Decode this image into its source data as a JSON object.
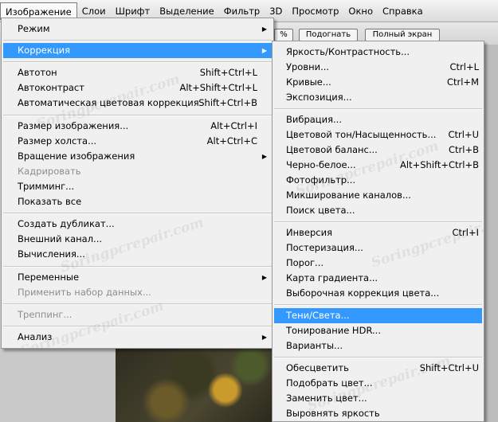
{
  "menubar": [
    "Изображение",
    "Слои",
    "Шрифт",
    "Выделение",
    "Фильтр",
    "3D",
    "Просмотр",
    "Окно",
    "Справка"
  ],
  "options_bar": {
    "fit_button": "Подогнать",
    "fullscreen_button": "Полный экран",
    "partial_button": "%"
  },
  "image_menu": {
    "mode": "Режим",
    "adjustments": "Коррекция",
    "auto_tone": {
      "label": "Автотон",
      "shortcut": "Shift+Ctrl+L"
    },
    "auto_contrast": {
      "label": "Автоконтраст",
      "shortcut": "Alt+Shift+Ctrl+L"
    },
    "auto_color": {
      "label": "Автоматическая цветовая коррекция",
      "shortcut": "Shift+Ctrl+B"
    },
    "image_size": {
      "label": "Размер изображения...",
      "shortcut": "Alt+Ctrl+I"
    },
    "canvas_size": {
      "label": "Размер холста...",
      "shortcut": "Alt+Ctrl+C"
    },
    "rotation": "Вращение изображения",
    "crop": "Кадрировать",
    "trim": "Тримминг...",
    "reveal_all": "Показать все",
    "duplicate": "Создать дубликат...",
    "apply_image": "Внешний канал...",
    "calculations": "Вычисления...",
    "variables": "Переменные",
    "apply_data_set": "Применить набор данных...",
    "trap": "Треппинг...",
    "analysis": "Анализ"
  },
  "adjustments_menu": {
    "brightness_contrast": {
      "label": "Яркость/Контрастность...",
      "shortcut": ""
    },
    "levels": {
      "label": "Уровни...",
      "shortcut": "Ctrl+L"
    },
    "curves": {
      "label": "Кривые...",
      "shortcut": "Ctrl+M"
    },
    "exposure": {
      "label": "Экспозиция...",
      "shortcut": ""
    },
    "vibrance": {
      "label": "Вибрация...",
      "shortcut": ""
    },
    "hue_saturation": {
      "label": "Цветовой тон/Насыщенность...",
      "shortcut": "Ctrl+U"
    },
    "color_balance": {
      "label": "Цветовой баланс...",
      "shortcut": "Ctrl+B"
    },
    "black_white": {
      "label": "Черно-белое...",
      "shortcut": "Alt+Shift+Ctrl+B"
    },
    "photo_filter": {
      "label": "Фотофильтр...",
      "shortcut": ""
    },
    "channel_mixer": {
      "label": "Микширование каналов...",
      "shortcut": ""
    },
    "color_lookup": {
      "label": "Поиск цвета...",
      "shortcut": ""
    },
    "invert": {
      "label": "Инверсия",
      "shortcut": "Ctrl+I"
    },
    "posterize": {
      "label": "Постеризация...",
      "shortcut": ""
    },
    "threshold": {
      "label": "Порог...",
      "shortcut": ""
    },
    "gradient_map": {
      "label": "Карта градиента...",
      "shortcut": ""
    },
    "selective_color": {
      "label": "Выборочная коррекция цвета...",
      "shortcut": ""
    },
    "shadows_highlights": {
      "label": "Тени/Света...",
      "shortcut": ""
    },
    "hdr_toning": {
      "label": "Тонирование HDR...",
      "shortcut": ""
    },
    "variations": {
      "label": "Варианты...",
      "shortcut": ""
    },
    "desaturate": {
      "label": "Обесцветить",
      "shortcut": "Shift+Ctrl+U"
    },
    "match_color": {
      "label": "Подобрать цвет...",
      "shortcut": ""
    },
    "replace_color": {
      "label": "Заменить цвет...",
      "shortcut": ""
    },
    "equalize": {
      "label": "Выровнять яркость",
      "shortcut": ""
    }
  },
  "watermark": "Soringpcrepair.com",
  "colors": {
    "highlight": "#3399ff",
    "menu_bg": "#f0f0f0",
    "disabled": "#8e8e8e"
  }
}
